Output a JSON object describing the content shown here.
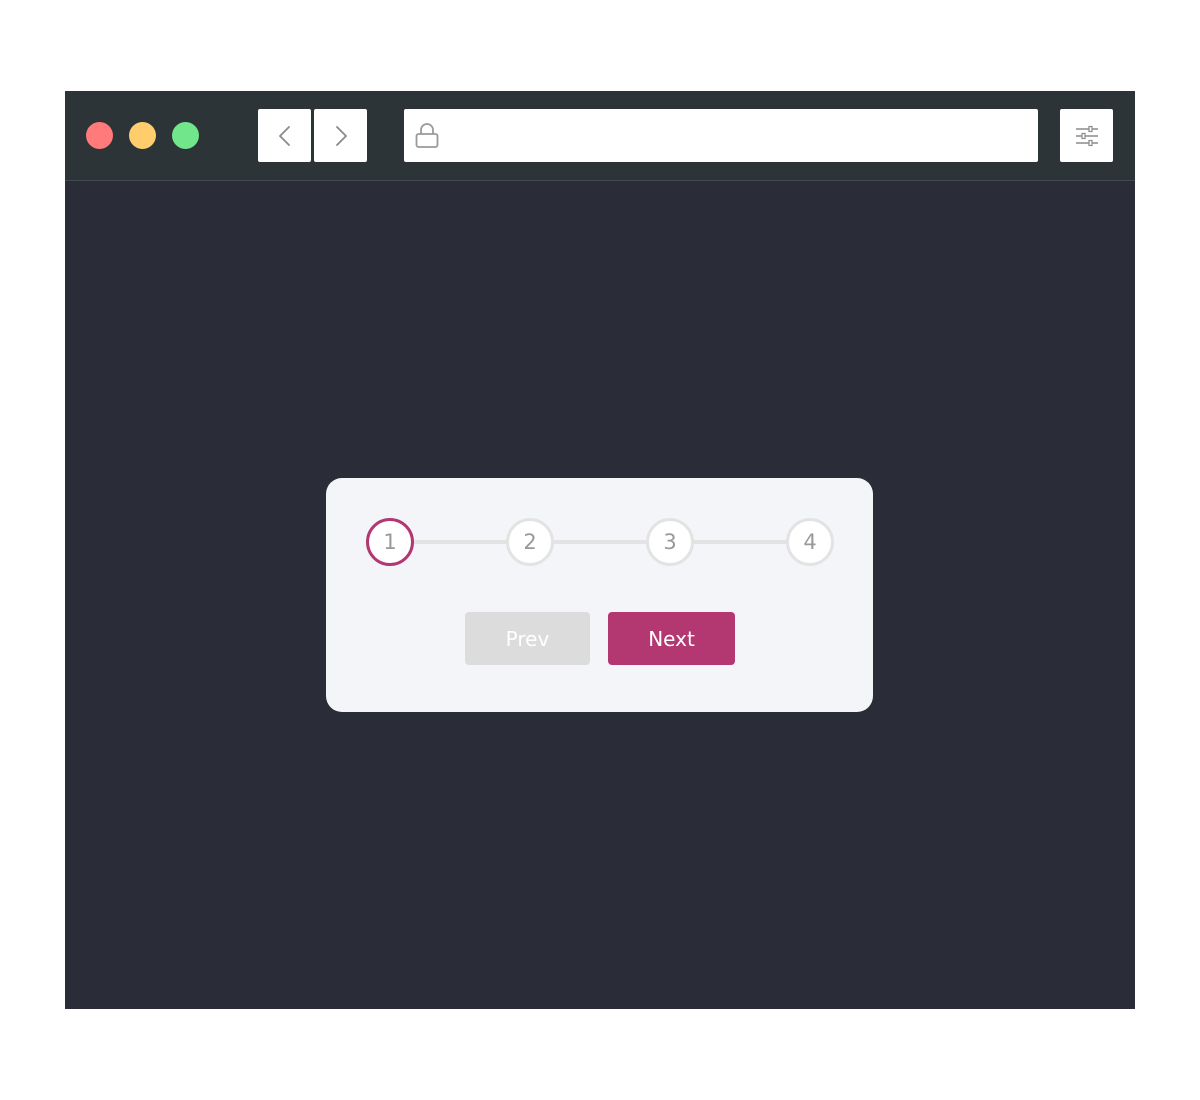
{
  "browser": {
    "url": "",
    "traffic_lights": {
      "close_color": "#ff7b7b",
      "minimize_color": "#ffcd6b",
      "maximize_color": "#71e68a"
    },
    "icons": {
      "back": "chevron-left-icon",
      "forward": "chevron-right-icon",
      "lock": "lock-icon",
      "settings": "sliders-icon"
    }
  },
  "stepper": {
    "steps": [
      "1",
      "2",
      "3",
      "4"
    ],
    "active_step": 1,
    "active_color": "#b33771",
    "inactive_color": "#e3e3e3"
  },
  "buttons": {
    "prev_label": "Prev",
    "next_label": "Next",
    "prev_disabled": true
  }
}
